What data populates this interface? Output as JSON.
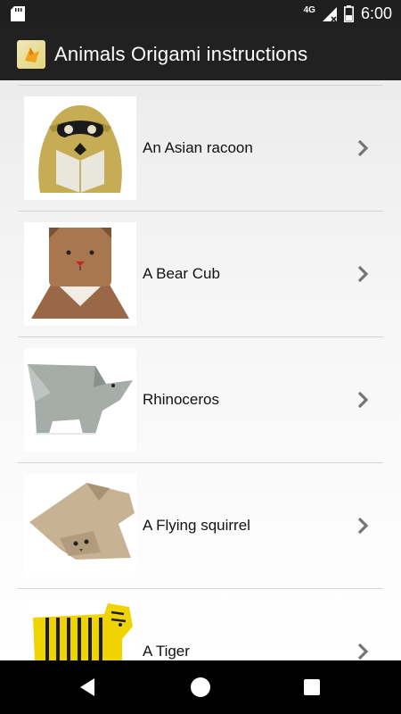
{
  "status_bar": {
    "time": "6:00",
    "network": "4G"
  },
  "app_bar": {
    "title": "Animals Origami instructions",
    "icon": "origami-app-icon"
  },
  "list": {
    "items": [
      {
        "label": "An Asian racoon",
        "thumbnail": "origami-racoon-image"
      },
      {
        "label": "A Bear Cub",
        "thumbnail": "origami-bear-cub-image"
      },
      {
        "label": "Rhinoceros",
        "thumbnail": "origami-rhinoceros-image"
      },
      {
        "label": "A Flying squirrel",
        "thumbnail": "origami-flying-squirrel-image"
      },
      {
        "label": "A Tiger",
        "thumbnail": "origami-tiger-image"
      }
    ]
  },
  "nav_bar": {
    "buttons": [
      "back",
      "home",
      "recents"
    ]
  },
  "colors": {
    "app_bar": "#212121",
    "status_bar": "#1f1f1f",
    "nav_bar": "#000000",
    "divider": "#d3d3d3",
    "chevron": "#757575"
  }
}
